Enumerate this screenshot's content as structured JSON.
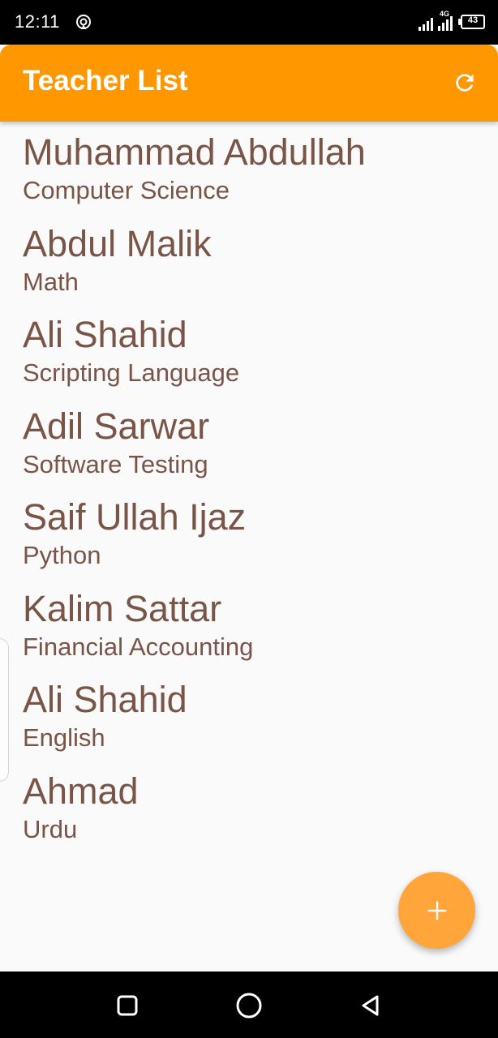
{
  "status_bar": {
    "time": "12:11",
    "network": "4G",
    "battery": "43",
    "icons": [
      "hotspot-icon",
      "signal-icon",
      "signal-icon",
      "battery-icon"
    ]
  },
  "app_bar": {
    "title": "Teacher List",
    "background_color": "#ff9800",
    "action_icon": "refresh-icon"
  },
  "teachers": [
    {
      "name": "Muhammad Abdullah",
      "subject": "Computer Science"
    },
    {
      "name": "Abdul Malik",
      "subject": "Math"
    },
    {
      "name": "Ali Shahid",
      "subject": "Scripting Language"
    },
    {
      "name": "Adil Sarwar",
      "subject": "Software Testing"
    },
    {
      "name": "Saif Ullah Ijaz",
      "subject": "Python"
    },
    {
      "name": "Kalim Sattar",
      "subject": "Financial Accounting"
    },
    {
      "name": "Ali Shahid",
      "subject": "English"
    },
    {
      "name": "Ahmad",
      "subject": "Urdu"
    }
  ],
  "text_color": "#795548",
  "fab": {
    "icon": "plus-icon",
    "color": "#ffa53a"
  },
  "nav_bar": {
    "icons": [
      "recents-icon",
      "home-icon",
      "back-icon"
    ]
  }
}
